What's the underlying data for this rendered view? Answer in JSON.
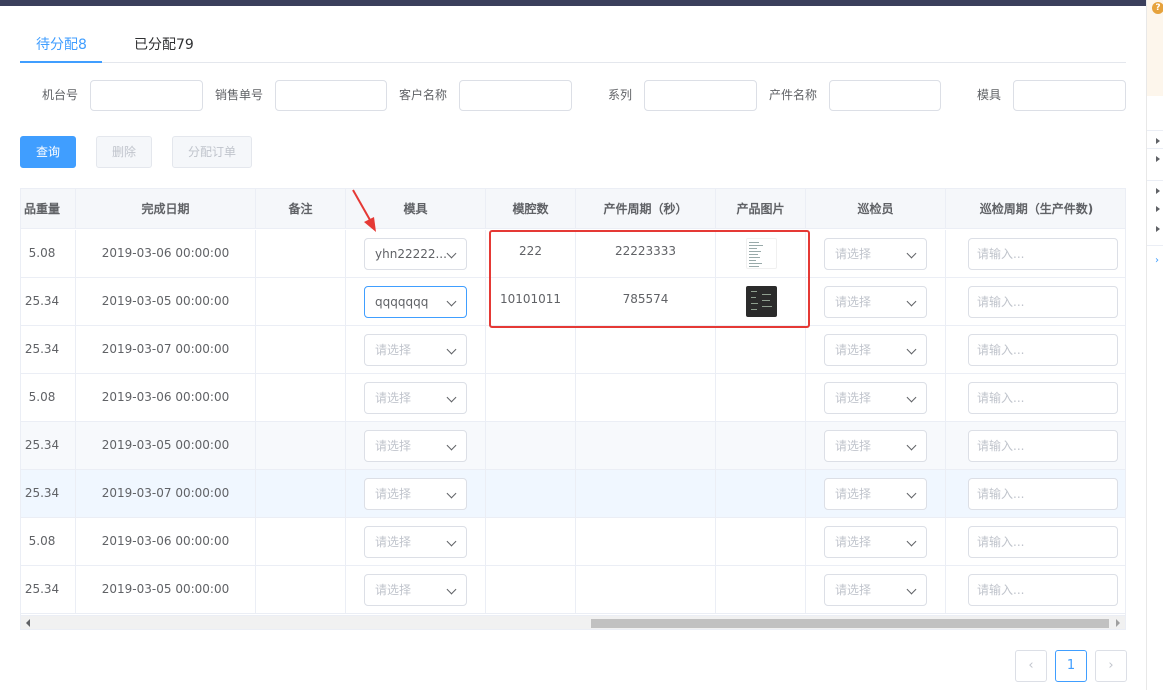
{
  "tabs": [
    {
      "label": "待分配8",
      "active": true
    },
    {
      "label": "已分配79",
      "active": false
    }
  ],
  "filters": [
    {
      "label": "机台号",
      "value": ""
    },
    {
      "label": "销售单号",
      "value": ""
    },
    {
      "label": "客户名称",
      "value": ""
    },
    {
      "label": "系列",
      "value": ""
    },
    {
      "label": "产件名称",
      "value": ""
    },
    {
      "label": "模具",
      "value": ""
    }
  ],
  "buttons": {
    "query": "查询",
    "delete": "删除",
    "assign": "分配订单"
  },
  "table": {
    "columns": [
      "品重量",
      "完成日期",
      "备注",
      "模具",
      "模腔数",
      "产件周期（秒）",
      "产品图片",
      "巡检员",
      "巡检周期（生产件数)"
    ],
    "select_placeholder": "请选择",
    "input_placeholder": "请输入...",
    "rows": [
      {
        "weight": "5.08",
        "date": "2019-03-06 00:00:00",
        "remark": "",
        "mold": "yhn22222...",
        "cavities": "222",
        "cycle": "22223333",
        "image": "light"
      },
      {
        "weight": "25.34",
        "date": "2019-03-05 00:00:00",
        "remark": "",
        "mold": "qqqqqqq",
        "cavities": "10101011",
        "cycle": "785574",
        "image": "dark"
      },
      {
        "weight": "25.34",
        "date": "2019-03-07 00:00:00",
        "remark": "",
        "mold": "",
        "cavities": "",
        "cycle": "",
        "image": ""
      },
      {
        "weight": "5.08",
        "date": "2019-03-06 00:00:00",
        "remark": "",
        "mold": "",
        "cavities": "",
        "cycle": "",
        "image": ""
      },
      {
        "weight": "25.34",
        "date": "2019-03-05 00:00:00",
        "remark": "",
        "mold": "",
        "cavities": "",
        "cycle": "",
        "image": ""
      },
      {
        "weight": "25.34",
        "date": "2019-03-07 00:00:00",
        "remark": "",
        "mold": "",
        "cavities": "",
        "cycle": "",
        "image": ""
      },
      {
        "weight": "5.08",
        "date": "2019-03-06 00:00:00",
        "remark": "",
        "mold": "",
        "cavities": "",
        "cycle": "",
        "image": ""
      },
      {
        "weight": "25.34",
        "date": "2019-03-05 00:00:00",
        "remark": "",
        "mold": "",
        "cavities": "",
        "cycle": "",
        "image": ""
      }
    ]
  },
  "pagination": {
    "prev_icon": "chevron-left-icon",
    "current_page": "1",
    "next_icon": "chevron-right-icon"
  },
  "colors": {
    "primary": "#409eff",
    "annotation": "#e53935",
    "header_bar": "#3b3f5c"
  }
}
